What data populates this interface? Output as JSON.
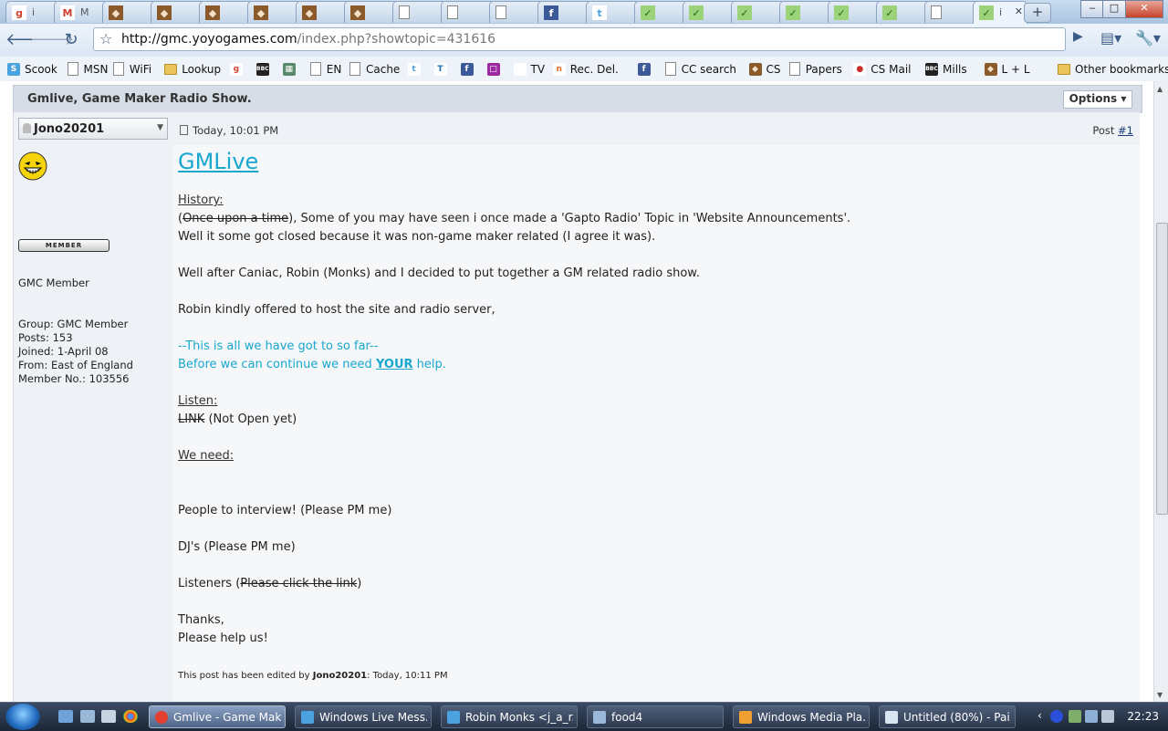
{
  "browser": {
    "tabs": [
      {
        "icon": "google-icon",
        "label": "i"
      },
      {
        "icon": "gmail-icon",
        "label": "M"
      },
      {
        "icon": "yoyogames-icon",
        "label": ""
      },
      {
        "icon": "yoyogames-icon",
        "label": ""
      },
      {
        "icon": "yoyogames-icon",
        "label": ""
      },
      {
        "icon": "yoyogames-icon",
        "label": ""
      },
      {
        "icon": "yoyogames-icon",
        "label": ""
      },
      {
        "icon": "yoyogames-icon",
        "label": ""
      },
      {
        "icon": "page-icon",
        "label": ""
      },
      {
        "icon": "page-icon",
        "label": ""
      },
      {
        "icon": "page-icon",
        "label": ""
      },
      {
        "icon": "facebook-icon",
        "label": ""
      },
      {
        "icon": "twitter-icon",
        "label": ""
      },
      {
        "icon": "check-icon",
        "label": ""
      },
      {
        "icon": "check-icon",
        "label": ""
      },
      {
        "icon": "check-icon",
        "label": ""
      },
      {
        "icon": "check-icon",
        "label": ""
      },
      {
        "icon": "check-icon",
        "label": ""
      },
      {
        "icon": "check-icon",
        "label": ""
      },
      {
        "icon": "page-icon",
        "label": ""
      },
      {
        "icon": "check-icon",
        "label": "i",
        "active": true
      }
    ],
    "new_tab_symbol": "+",
    "window_controls": {
      "minimize": "‒",
      "maximize": "□",
      "close": "✕"
    },
    "url_host": "http://gmc.yoyogames.com",
    "url_path": "/index.php?showtopic=431616",
    "bookmarks": [
      {
        "label": "Scook",
        "icon": "scook-icon"
      },
      {
        "label": "MSN",
        "icon": "page-icon"
      },
      {
        "label": "WiFi",
        "icon": "page-icon"
      },
      {
        "label": "Lookup",
        "icon": "folder-icon"
      },
      {
        "label": "",
        "icon": "google-icon"
      },
      {
        "label": "",
        "icon": "bbc-icon"
      },
      {
        "label": "",
        "icon": "image-icon"
      },
      {
        "label": "EN",
        "icon": "page-icon"
      },
      {
        "label": "Cache",
        "icon": "page-icon"
      },
      {
        "label": "",
        "icon": "twitter-icon"
      },
      {
        "label": "",
        "icon": "tinyurl-icon"
      },
      {
        "label": "",
        "icon": "facebook-icon"
      },
      {
        "label": "",
        "icon": "purple-square-icon"
      },
      {
        "label": "TV",
        "icon": "blank-icon"
      },
      {
        "label": "Rec. Del.",
        "icon": "n-icon"
      },
      {
        "label": "",
        "icon": "facebook-icon"
      },
      {
        "label": "CC search",
        "icon": "page-icon"
      },
      {
        "label": "CS",
        "icon": "yoyogames-icon"
      },
      {
        "label": "Papers",
        "icon": "page-icon"
      },
      {
        "label": "CS Mail",
        "icon": "mail-icon"
      },
      {
        "label": "Mills",
        "icon": "bbc-icon"
      },
      {
        "label": "L + L",
        "icon": "yoyogames-icon"
      }
    ],
    "other_bookmarks": "Other bookmarks"
  },
  "topic": {
    "title": "Gmlive, Game Maker Radio Show.",
    "options_label": "Options ▾"
  },
  "author": {
    "name": "Jono20201",
    "title": "GMC Member",
    "rank_badge": "MEMBER",
    "group": "Group: GMC Member",
    "posts": "Posts: 153",
    "joined": "Joined: 1-April 08",
    "from": "From: East of England",
    "member_no": "Member No.: 103556"
  },
  "post": {
    "date": "Today, 10:01 PM",
    "number_prefix": "Post ",
    "number": "#1",
    "heading": "GMLive",
    "history_label": "History:",
    "line1_open": "(",
    "line1_strike": "Once upon a time",
    "line1_rest": "), Some of you may have seen i once made a 'Gapto Radio' Topic in 'Website Announcements'.",
    "line2": "Well it some got closed because it was non-game maker related (I agree it was).",
    "line3": "Well after Caniac, Robin (Monks) and I decided to put together a GM related radio show.",
    "line4": "Robin kindly offered to host the site and radio server,",
    "cyan1": "--This is all we have got to so far--",
    "cyan2_pre": "Before we can continue we need ",
    "cyan2_emph": "YOUR",
    "cyan2_post": " help.",
    "listen_label": "Listen:",
    "link_strike": "LINK",
    "link_rest": " (Not Open yet)",
    "need_label": "We need:",
    "need1": "People to interview! (Please PM me)",
    "need2": "DJ's (Please PM me)",
    "need3_pre": "Listeners (",
    "need3_strike": "Please click the link",
    "need3_post": ")",
    "thanks": "Thanks,",
    "please": "Please help us!",
    "edit_pre": "This post has been edited by ",
    "edit_user": "Jono20201",
    "edit_post": ": Today, 10:11 PM"
  },
  "taskbar": {
    "items": [
      {
        "label": "Gmlive - Game Mak...",
        "icon": "chrome-icon",
        "active": true
      },
      {
        "label": "Windows Live Mess...",
        "icon": "messenger-icon"
      },
      {
        "label": "Robin Monks <j_a_r...",
        "icon": "messenger-icon"
      },
      {
        "label": "food4",
        "icon": "app-icon"
      },
      {
        "label": "Windows Media Pla...",
        "icon": "media-player-icon"
      },
      {
        "label": "Untitled (80%) - Pai...",
        "icon": "paint-icon"
      }
    ],
    "clock": "22:23"
  },
  "colors": {
    "link_cyan": "#18a7cf",
    "topic_bar": "#d7dde6",
    "sidebar_bg": "#eef1f5"
  }
}
